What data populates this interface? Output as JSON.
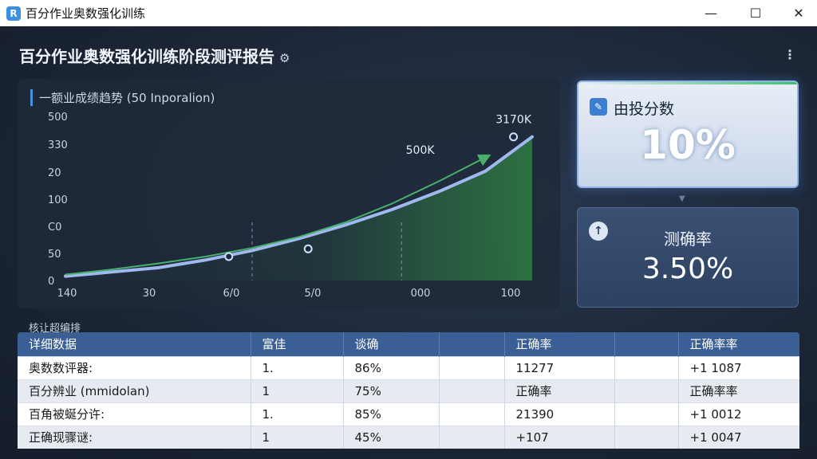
{
  "window": {
    "title": "百分作业奥数强化训练",
    "app_icon_glyph": "R",
    "controls": {
      "minimize": "—",
      "maximize": "☐",
      "close": "✕"
    }
  },
  "page": {
    "title": "百分作业奥数强化训练阶段测评报告",
    "settings_glyph": "⚙",
    "more_glyph": "⋮"
  },
  "chart_panel": {
    "title": "一额业成绩趋势 (50 Inporalion)"
  },
  "chart_data": {
    "type": "line",
    "title": "一额业成绩趋势 (50 Inporalion)",
    "xlabel": "",
    "ylabel": "",
    "x_tick_labels": [
      "140",
      "30",
      "6/0",
      "5/0",
      "000",
      "100"
    ],
    "y_tick_labels": [
      "0",
      "50",
      "C0",
      "100",
      "20",
      "330",
      "500"
    ],
    "series": [
      {
        "color": "#9fb8ee",
        "x": [
          0,
          0.5,
          1,
          1.5,
          2,
          2.5,
          3,
          3.5,
          4,
          4.5,
          5
        ],
        "y": [
          0.25,
          0.5,
          0.75,
          1.2,
          1.75,
          2.45,
          3.25,
          4.15,
          5.2,
          6.4,
          8.4
        ]
      },
      {
        "color": "#3a8a84",
        "x": [
          0,
          0.5,
          1,
          1.5,
          2,
          2.5,
          3,
          3.5,
          4,
          4.5
        ],
        "y": [
          0.35,
          0.65,
          1.0,
          1.4,
          1.9,
          2.55,
          3.4,
          4.5,
          5.8,
          7.2
        ]
      }
    ],
    "markers": [
      {
        "x": 1.75,
        "y": 1.4
      },
      {
        "x": 2.6,
        "y": 1.85
      },
      {
        "x": 4.8,
        "y": 8.4
      }
    ],
    "annotations": [
      {
        "text": "3170K",
        "x": 4.8,
        "y": 9.2
      },
      {
        "text": "500K",
        "x": 3.8,
        "y": 7.4
      }
    ],
    "grid": false,
    "colors": {
      "fill": "#2f7d43",
      "arrow": "#48b06a"
    }
  },
  "card_score": {
    "icon": "document-chart-icon",
    "icon_glyph": "✎",
    "label": "由投分数",
    "value": "10%"
  },
  "card_accuracy": {
    "icon": "arrow-up-icon",
    "icon_glyph": "↑",
    "label": "测确率",
    "value": "3.50%"
  },
  "connector_glyph": "▼",
  "table_section_label": "核让超编排",
  "table": {
    "headers": [
      "详细数据",
      "富佳",
      "谈确",
      "",
      "正确率",
      "",
      "正确率率"
    ],
    "rows": [
      [
        "奥数数评器:",
        "1.",
        "86%",
        "",
        "11277",
        "",
        "+1 1087"
      ],
      [
        "百分辨业 (mmidolan)",
        "1",
        "75%",
        "",
        "正确率",
        "",
        "正确率率"
      ],
      [
        "百角被蜒分许:",
        "1.",
        "85%",
        "",
        "21390",
        "",
        "+1 0012"
      ],
      [
        "正确现骤谜:",
        "1",
        "45%",
        "",
        "+107",
        "",
        "+1 0047"
      ]
    ]
  }
}
